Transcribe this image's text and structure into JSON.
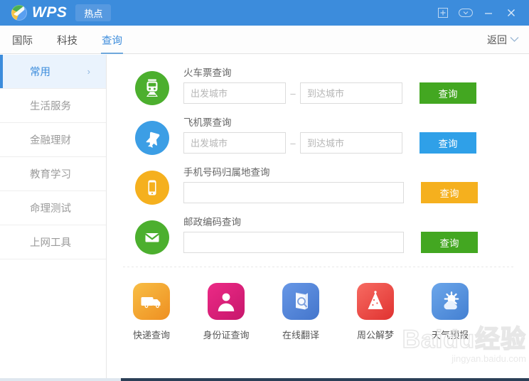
{
  "titlebar": {
    "brand": "WPS",
    "tab_label": "热点",
    "controls": [
      {
        "name": "new-tab-button",
        "icon": "square-plus-icon"
      },
      {
        "name": "tab-list-button",
        "icon": "oval-chevron-down-icon"
      },
      {
        "name": "minimize-button",
        "icon": "minimize-icon"
      },
      {
        "name": "close-button",
        "icon": "close-icon"
      }
    ]
  },
  "navbar": {
    "tabs": [
      {
        "label": "国际",
        "active": false
      },
      {
        "label": "科技",
        "active": false
      },
      {
        "label": "查询",
        "active": true
      }
    ],
    "back_label": "返回"
  },
  "sidebar": {
    "items": [
      {
        "label": "常用",
        "active": true,
        "arrow": "›"
      },
      {
        "label": "生活服务",
        "active": false,
        "arrow": ""
      },
      {
        "label": "金融理财",
        "active": false,
        "arrow": ""
      },
      {
        "label": "教育学习",
        "active": false,
        "arrow": ""
      },
      {
        "label": "命理测试",
        "active": false,
        "arrow": ""
      },
      {
        "label": "上网工具",
        "active": false,
        "arrow": ""
      }
    ]
  },
  "forms": [
    {
      "id": "train",
      "title": "火车票查询",
      "icon": "train-icon",
      "icon_color": "#4CAF2E",
      "button_label": "查询",
      "button_color": "#43A721",
      "dual": true,
      "dash": "–",
      "from_placeholder": "出发城市",
      "to_placeholder": "到达城市",
      "from_value": "",
      "to_value": ""
    },
    {
      "id": "flight",
      "title": "飞机票查询",
      "icon": "airplane-icon",
      "icon_color": "#3C9EE5",
      "button_label": "查询",
      "button_color": "#2FA0E8",
      "dual": true,
      "dash": "–",
      "from_placeholder": "出发城市",
      "to_placeholder": "到达城市",
      "from_value": "",
      "to_value": ""
    },
    {
      "id": "phone",
      "title": "手机号码归属地查询",
      "icon": "mobile-phone-icon",
      "icon_color": "#F5B01E",
      "button_label": "查询",
      "button_color": "#F5B01E",
      "dual": false,
      "placeholder": "",
      "value": ""
    },
    {
      "id": "postcode",
      "title": "邮政编码查询",
      "icon": "envelope-icon",
      "icon_color": "#4CAF2E",
      "button_label": "查询",
      "button_color": "#43A721",
      "dual": false,
      "placeholder": "",
      "value": ""
    }
  ],
  "shortcuts": [
    {
      "label": "快递查询",
      "icon": "delivery-truck-icon",
      "color_a": "#F7B733",
      "color_b": "#F0932B"
    },
    {
      "label": "身份证查询",
      "icon": "id-person-icon",
      "color_a": "#E8197E",
      "color_b": "#C9186E"
    },
    {
      "label": "在线翻译",
      "icon": "book-search-icon",
      "color_a": "#5B8FE0",
      "color_b": "#4A7CD0"
    },
    {
      "label": "周公解梦",
      "icon": "party-hat-icon",
      "color_a": "#F4514E",
      "color_b": "#E03B38"
    },
    {
      "label": "天气预报",
      "icon": "sun-cloud-icon",
      "color_a": "#5B9BE5",
      "color_b": "#4A86D6"
    }
  ],
  "watermark": {
    "main": "Baidu经验",
    "sub": "jingyan.baidu.com"
  }
}
